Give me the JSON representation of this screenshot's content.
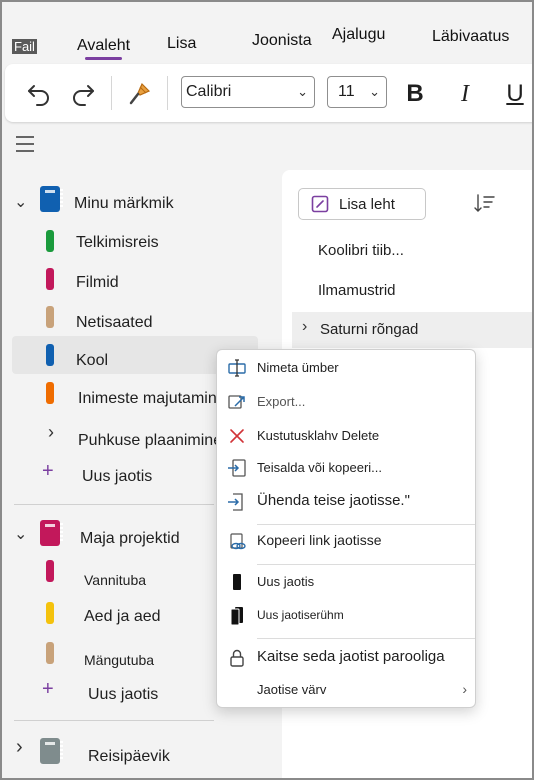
{
  "menubar": {
    "file": "Fail",
    "home": "Avaleht",
    "insert": "Lisa",
    "draw": "Joonista",
    "history": "Ajalugu",
    "review": "Läbivaatus"
  },
  "toolbar": {
    "font_name": "Calibri",
    "font_size": "11",
    "bold": "B",
    "italic": "I",
    "underline": "U"
  },
  "notebooks": [
    {
      "name": "Minu märkmik",
      "color": "#1060b0",
      "sections": [
        {
          "name": "Telkimisreis",
          "color": "#1a9a3c"
        },
        {
          "name": "Filmid",
          "color": "#c2185b"
        },
        {
          "name": "Netisaated",
          "color": "#c8a27a"
        },
        {
          "name": "Kool",
          "color": "#1060b0",
          "selected": true
        },
        {
          "name": "Inimeste majutamine",
          "color": "#ef6c00"
        },
        {
          "name": "Puhkuse plaanimine",
          "group": true
        }
      ],
      "add_section": "Uus jaotis"
    },
    {
      "name": "Maja projektid",
      "color": "#c2185b",
      "sections": [
        {
          "name": "Vannituba",
          "color": "#c2185b"
        },
        {
          "name": "Aed ja aed",
          "color": "#f4c20d"
        },
        {
          "name": "Mängutuba",
          "color": "#c8a27a"
        }
      ],
      "add_section": "Uus jaotis"
    },
    {
      "name": "Reisipäevik",
      "color": "#7f8c8d",
      "collapsed": true
    }
  ],
  "pages": {
    "add_page": "Lisa leht",
    "items": [
      "Koolibri tiib...",
      "Ilmamustrid",
      "Saturni rõngad"
    ]
  },
  "context_menu": {
    "items": [
      {
        "label": "Nimeta ümber",
        "icon": "rename-icon"
      },
      {
        "label": "Export...",
        "icon": "export-icon"
      },
      {
        "label": "Kustutusklahv Delete",
        "icon": "delete-icon"
      },
      {
        "label": "Teisalda või kopeeri...",
        "icon": "move-copy-icon"
      },
      {
        "label": "Ühenda teise jaotisse.\"",
        "icon": "merge-icon"
      },
      {
        "label": "Kopeeri link jaotisse",
        "icon": "link-icon"
      },
      {
        "label": "Uus jaotis",
        "icon": "new-section-icon"
      },
      {
        "label": "Uus jaotiserühm",
        "icon": "new-section-group-icon"
      },
      {
        "label": "Kaitse seda jaotist parooliga",
        "icon": "lock-icon"
      },
      {
        "label": "Jaotise värv",
        "icon": "section-color-icon"
      }
    ]
  }
}
